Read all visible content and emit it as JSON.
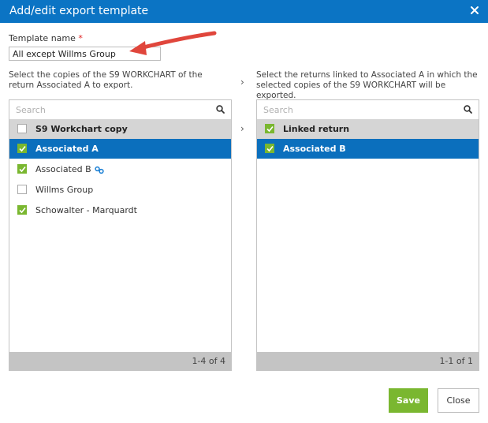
{
  "dialog": {
    "title": "Add/edit export template"
  },
  "template_name": {
    "label": "Template name",
    "required_mark": "*",
    "value": "All except Willms Group"
  },
  "left": {
    "description": "Select the copies of the S9 WORKCHART of the return Associated A to export.",
    "search_placeholder": "Search",
    "header": "S9 Workchart copy",
    "items": [
      {
        "label": "Associated A",
        "checked": true,
        "selected": true
      },
      {
        "label": "Associated B",
        "checked": true,
        "selected": false,
        "icon": "link-icon"
      },
      {
        "label": "Willms Group",
        "checked": false,
        "selected": false
      },
      {
        "label": "Schowalter - Marquardt",
        "checked": true,
        "selected": false
      }
    ],
    "count": "1-4 of 4"
  },
  "right": {
    "description": "Select the returns linked to Associated A in which the selected copies of the S9 WORKCHART will be exported.",
    "search_placeholder": "Search",
    "header": "Linked return",
    "items": [
      {
        "label": "Associated B",
        "checked": true,
        "selected": true
      }
    ],
    "count": "1-1 of 1"
  },
  "buttons": {
    "save": "Save",
    "close": "Close"
  },
  "colors": {
    "title_bar": "#0b74c4",
    "selected_row": "#0b6fbd",
    "checkbox_checked": "#7ab730",
    "save_button": "#7ab730",
    "arrow": "#e0463c"
  }
}
